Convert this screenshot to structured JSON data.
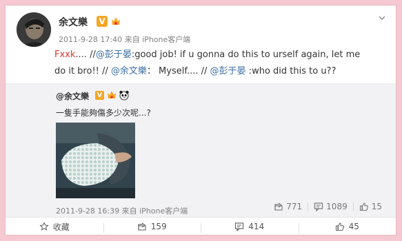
{
  "post": {
    "username": "余文樂",
    "verified_badge": "V",
    "timestamp": "2011-9-28 17:40",
    "source_prefix": "来自",
    "source": "iPhone客户端",
    "content": {
      "part1": "Fxxk",
      "part2": ".... //",
      "mention1": "@彭于晏",
      "part3": ":good job! if u gonna do this to urself again, let me do it bro!!  // ",
      "mention2": "@余文樂",
      "part4": "： Myself.... // ",
      "mention3": "@彭于晏",
      "part5": " :who did this to u??"
    }
  },
  "repost": {
    "username": "@余文樂",
    "verified_badge": "V",
    "text": "一隻手能夠傷多少次呢...?",
    "timestamp": "2011-9-28 16:39",
    "source_prefix": "来自",
    "source": "iPhone客户端",
    "actions": {
      "repost_count": "771",
      "comment_count": "1089",
      "like_count": "15"
    }
  },
  "actions_bar": {
    "favorite_label": "收藏",
    "repost_count": "159",
    "comment_count": "414",
    "like_count": "45"
  },
  "colors": {
    "background": "#f6c9d2",
    "mention": "#3b6ea5",
    "highlight": "#e0362c",
    "verified": "#f5a623"
  }
}
